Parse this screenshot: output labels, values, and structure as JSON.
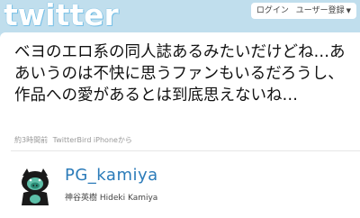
{
  "header": {
    "logo_text": "twitter",
    "nav": {
      "login": "ログイン",
      "signup": "ユーザー登録"
    }
  },
  "tweet": {
    "text": "ベヨのエロ系の同人誌あるみたいだけどね…ああいうのは不快に思うファンもいるだろうし、作品への愛があるとは到底思えないね…",
    "time": "約3時間前",
    "source": "TwitterBird iPhoneから"
  },
  "user": {
    "screen_name": "PG_kamiya",
    "name": "神谷英樹 Hideki Kamiya"
  },
  "colors": {
    "background": "#c0deed",
    "link": "#2b7bb9"
  }
}
